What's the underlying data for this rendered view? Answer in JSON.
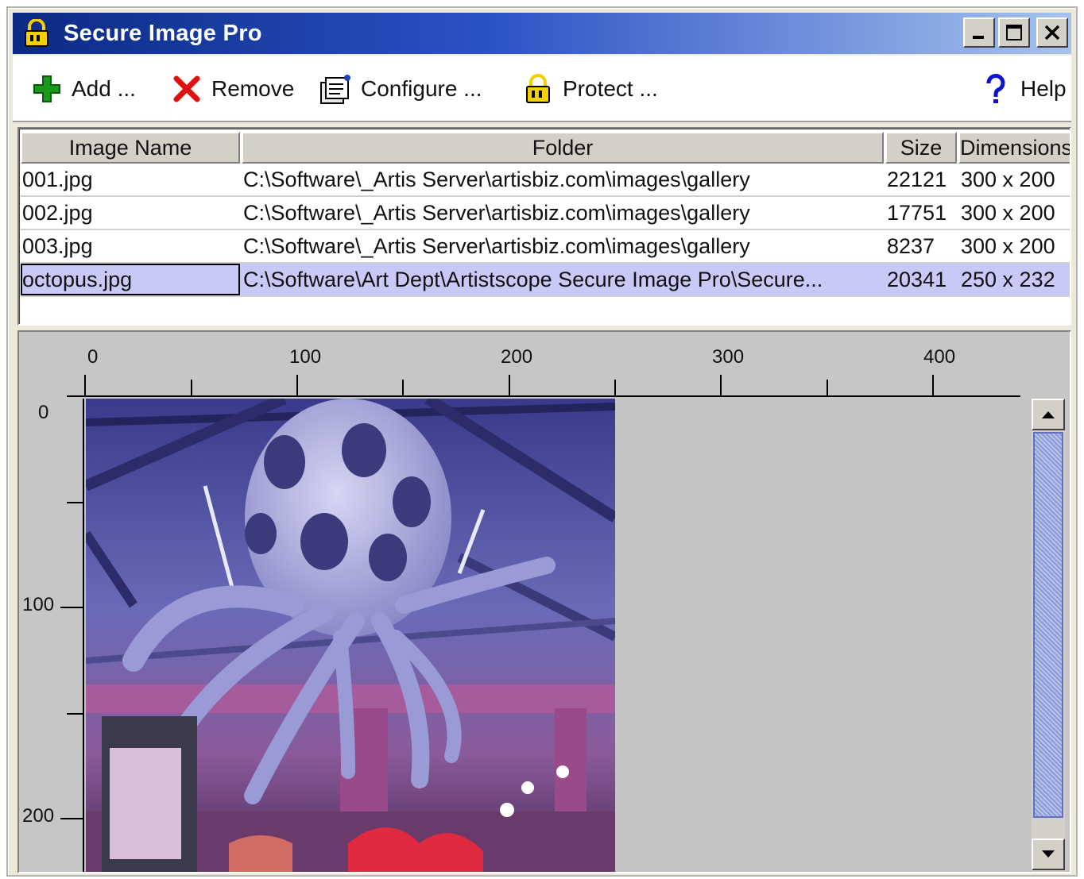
{
  "window": {
    "title": "Secure Image Pro"
  },
  "toolbar": {
    "add_label": "Add ...",
    "remove_label": "Remove",
    "configure_label": "Configure ...",
    "protect_label": "Protect ...",
    "help_label": "Help"
  },
  "table": {
    "columns": [
      "Image Name",
      "Folder",
      "Size",
      "Dimensions"
    ],
    "rows": [
      {
        "name": "001.jpg",
        "folder": "C:\\Software\\_Artis Server\\artisbiz.com\\images\\gallery",
        "size": "22121",
        "dimensions": "300 x 200"
      },
      {
        "name": "002.jpg",
        "folder": "C:\\Software\\_Artis Server\\artisbiz.com\\images\\gallery",
        "size": "17751",
        "dimensions": "300 x 200"
      },
      {
        "name": "003.jpg",
        "folder": "C:\\Software\\_Artis Server\\artisbiz.com\\images\\gallery",
        "size": "8237",
        "dimensions": "300 x 200"
      },
      {
        "name": "octopus.jpg",
        "folder": "C:\\Software\\Art Dept\\Artistscope Secure Image Pro\\Secure...",
        "size": "20341",
        "dimensions": "250 x 232"
      }
    ],
    "selected_index": 3
  },
  "preview": {
    "ruler_top_labels": [
      "0",
      "100",
      "200",
      "300",
      "400"
    ],
    "ruler_left_labels": [
      "0",
      "100",
      "200"
    ]
  },
  "colors": {
    "title_start": "#0a2a84",
    "title_end": "#a6c3ee",
    "selection": "#c9c9f7",
    "add_icon": "#1a9a1a",
    "remove_icon": "#e01010",
    "help_icon": "#1010d0"
  },
  "icons": {
    "title": "padlock-icon",
    "add": "plus-icon",
    "remove": "x-icon",
    "configure": "document-gear-icon",
    "protect": "padlock-icon",
    "help": "question-icon"
  }
}
